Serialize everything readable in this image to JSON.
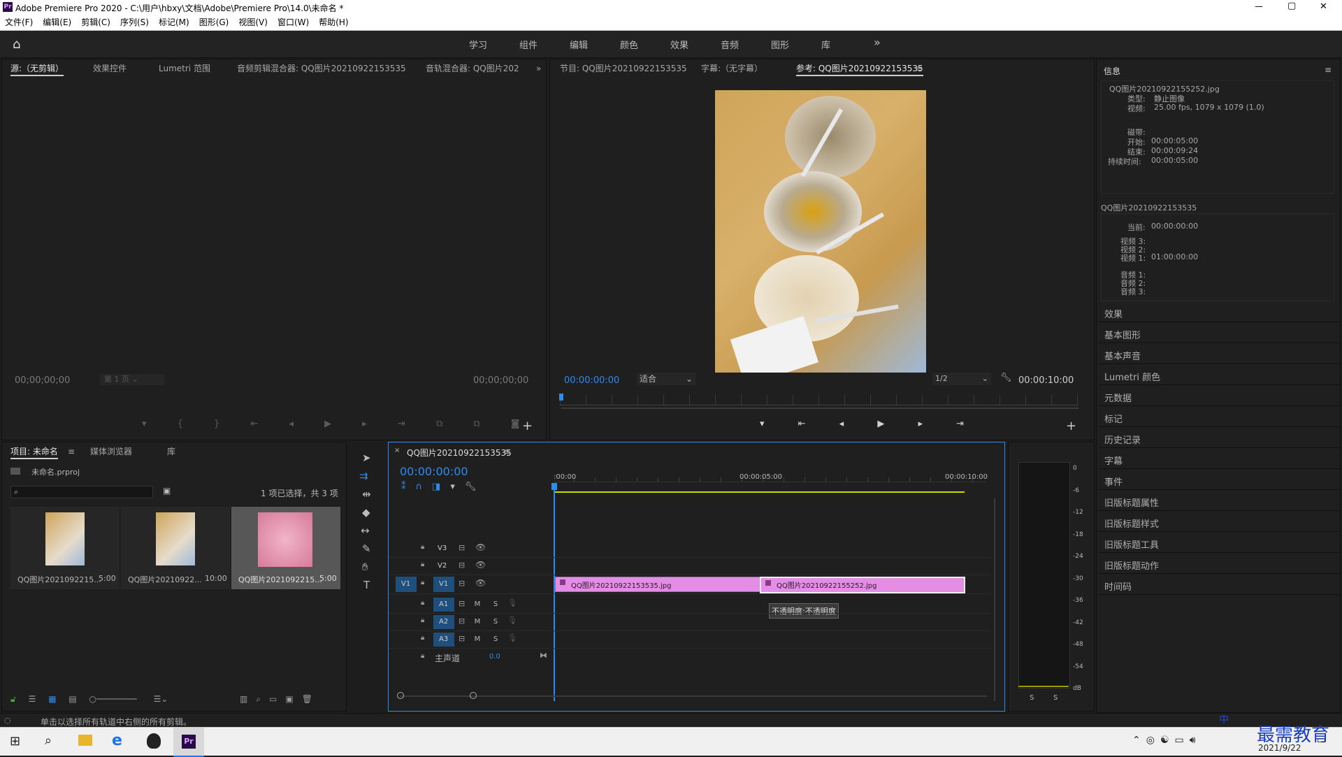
{
  "window": {
    "title": "Adobe Premiere Pro 2020 - C:\\用户\\hbxy\\文档\\Adobe\\Premiere Pro\\14.0\\未命名 *",
    "minimize": "—",
    "maximize": "▢",
    "close": "✕"
  },
  "menu": [
    "文件(F)",
    "编辑(E)",
    "剪辑(C)",
    "序列(S)",
    "标记(M)",
    "图形(G)",
    "视图(V)",
    "窗口(W)",
    "帮助(H)"
  ],
  "workspaces": [
    "学习",
    "组件",
    "编辑",
    "颜色",
    "效果",
    "音频",
    "图形",
    "库"
  ],
  "workspaces_more": "»",
  "source_panel": {
    "tabs": [
      "源:（无剪辑）",
      "效果控件",
      "Lumetri 范围",
      "音频剪辑混合器: QQ图片20210922153535",
      "音轨混合器: QQ图片202"
    ],
    "timecode_left": "00;00;00;00",
    "timecode_right": "00;00;00;00",
    "page_select": "第 1 页"
  },
  "program_panel": {
    "tabs": [
      "节目: QQ图片20210922153535",
      "字幕:（无字幕）",
      "参考: QQ图片20210922153535"
    ],
    "timecode": "00:00:00:00",
    "fit": "适合",
    "resolution": "1/2",
    "duration": "00:00:10:00"
  },
  "info_panel": {
    "title": "信息",
    "clip_name": "QQ图片20210922155252.jpg",
    "type_label": "类型:",
    "type_value": "静止图像",
    "video_label": "视频:",
    "video_value": "25.00 fps, 1079 x 1079 (1.0)",
    "tape_label": "磁带:",
    "start_label": "开始:",
    "start_value": "00:00:05:00",
    "end_label": "结束:",
    "end_value": "00:00:09:24",
    "dur_label": "持续时间:",
    "dur_value": "00:00:05:00",
    "seq_name": "QQ图片20210922153535",
    "current_label": "当前:",
    "current_value": "00:00:00:00",
    "v3": "视频 3:",
    "v2": "视频 2:",
    "v1": "视频 1:",
    "v1_value": "01:00:00:00",
    "a1": "音频 1:",
    "a2": "音频 2:",
    "a3": "音频 3:"
  },
  "side_panels": [
    "效果",
    "基本图形",
    "基本声音",
    "Lumetri 颜色",
    "元数据",
    "标记",
    "历史记录",
    "字幕",
    "事件",
    "旧版标题属性",
    "旧版标题样式",
    "旧版标题工具",
    "旧版标题动作",
    "时间码"
  ],
  "project_panel": {
    "tabs": [
      "项目: 未命名",
      "媒体浏览器",
      "库"
    ],
    "project_file": "未命名.prproj",
    "selection_info": "1 项已选择，共 3 项",
    "items": [
      {
        "name": "QQ图片2021092215...",
        "duration": "5:00"
      },
      {
        "name": "QQ图片20210922...",
        "duration": "10:00"
      },
      {
        "name": "QQ图片2021092215...",
        "duration": "5:00"
      }
    ]
  },
  "timeline": {
    "tab": "QQ图片20210922153535",
    "timecode": "00:00:00:00",
    "ruler": [
      ":00:00",
      "00:00:05:00",
      "00:00:10:00"
    ],
    "tracks_video": [
      "V3",
      "V2",
      "V1"
    ],
    "tracks_audio": [
      "A1",
      "A2",
      "A3"
    ],
    "master_label": "主声道",
    "master_value": "0.0",
    "clips": [
      {
        "name": "QQ图片20210922153535.jpg",
        "color": "#e58ce5"
      },
      {
        "name": "QQ图片20210922155252.jpg",
        "color": "#e58ce5"
      }
    ],
    "tooltip": "不透明度:不透明度",
    "m": "M",
    "s": "S"
  },
  "meter": {
    "scale": [
      "0",
      "-6",
      "-12",
      "-18",
      "-24",
      "-30",
      "-36",
      "-42",
      "-48",
      "-54",
      "dB"
    ],
    "solo": [
      "S",
      "S"
    ]
  },
  "status": "单击以选择所有轨道中右侧的所有剪辑。",
  "taskbar": {
    "date": "2021/9/22",
    "ime": "中",
    "watermark": "最需教育"
  },
  "colors": {
    "accent": "#2d8ceb",
    "clip": "#e58ce5",
    "playhead_bar": "#d6d600"
  }
}
